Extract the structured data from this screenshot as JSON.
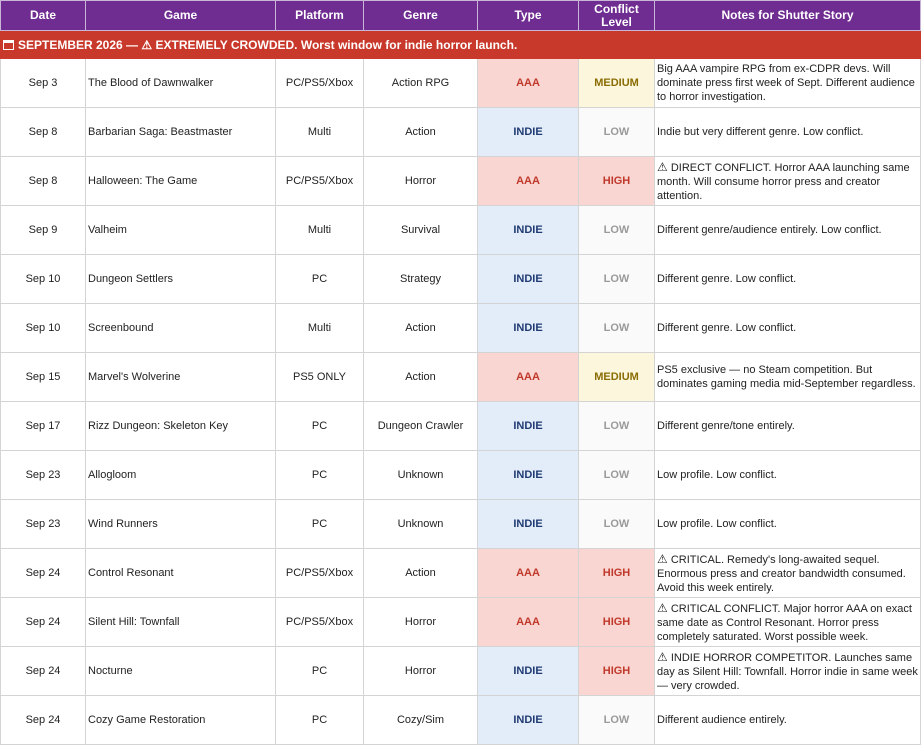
{
  "columns": [
    "Date",
    "Game",
    "Platform",
    "Genre",
    "Type",
    "Conflict Level",
    "Notes for Shutter Story"
  ],
  "banner": {
    "month_text": "SEPTEMBER 2026 — ",
    "warning_glyph": "⚠",
    "warning_text": " EXTREMELY CROWDED. Worst window for indie horror launch."
  },
  "colors": {
    "header_bg": "#6f2c91",
    "banner_bg": "#c8392b",
    "aaa_bg": "#f9d6d2",
    "indie_bg": "#e3edf9",
    "medium_bg": "#fcf6dc"
  },
  "rows": [
    {
      "date": "Sep 3",
      "game": "The Blood of Dawnwalker",
      "platform": "PC/PS5/Xbox",
      "genre": "Action RPG",
      "type": "AAA",
      "level": "MEDIUM",
      "warn": "",
      "notes": "Big AAA vampire RPG from ex-CDPR devs. Will dominate press first week of Sept. Different audience to horror investigation."
    },
    {
      "date": "Sep 8",
      "game": "Barbarian Saga: Beastmaster",
      "platform": "Multi",
      "genre": "Action",
      "type": "INDIE",
      "level": "LOW",
      "warn": "",
      "notes": "Indie but very different genre. Low conflict."
    },
    {
      "date": "Sep 8",
      "game": "Halloween: The Game",
      "platform": "PC/PS5/Xbox",
      "genre": "Horror",
      "type": "AAA",
      "level": "HIGH",
      "warn": "⚠",
      "notes": " DIRECT CONFLICT. Horror AAA launching same month. Will consume horror press and creator attention."
    },
    {
      "date": "Sep 9",
      "game": "Valheim",
      "platform": "Multi",
      "genre": "Survival",
      "type": "INDIE",
      "level": "LOW",
      "warn": "",
      "notes": "Different genre/audience entirely. Low conflict."
    },
    {
      "date": "Sep 10",
      "game": "Dungeon Settlers",
      "platform": "PC",
      "genre": "Strategy",
      "type": "INDIE",
      "level": "LOW",
      "warn": "",
      "notes": "Different genre. Low conflict."
    },
    {
      "date": "Sep 10",
      "game": "Screenbound",
      "platform": "Multi",
      "genre": "Action",
      "type": "INDIE",
      "level": "LOW",
      "warn": "",
      "notes": "Different genre. Low conflict."
    },
    {
      "date": "Sep 15",
      "game": "Marvel's Wolverine",
      "platform": "PS5 ONLY",
      "genre": "Action",
      "type": "AAA",
      "level": "MEDIUM",
      "warn": "",
      "notes": "PS5 exclusive — no Steam competition. But dominates gaming media mid-September regardless."
    },
    {
      "date": "Sep 17",
      "game": "Rizz Dungeon: Skeleton Key",
      "platform": "PC",
      "genre": "Dungeon Crawler",
      "type": "INDIE",
      "level": "LOW",
      "warn": "",
      "notes": "Different genre/tone entirely."
    },
    {
      "date": "Sep 23",
      "game": "Allogloom",
      "platform": "PC",
      "genre": "Unknown",
      "type": "INDIE",
      "level": "LOW",
      "warn": "",
      "notes": "Low profile. Low conflict."
    },
    {
      "date": "Sep 23",
      "game": "Wind Runners",
      "platform": "PC",
      "genre": "Unknown",
      "type": "INDIE",
      "level": "LOW",
      "warn": "",
      "notes": "Low profile. Low conflict."
    },
    {
      "date": "Sep 24",
      "game": "Control Resonant",
      "platform": "PC/PS5/Xbox",
      "genre": "Action",
      "type": "AAA",
      "level": "HIGH",
      "warn": "⚠",
      "notes": " CRITICAL. Remedy's long-awaited sequel. Enormous press and creator bandwidth consumed. Avoid this week entirely."
    },
    {
      "date": "Sep 24",
      "game": "Silent Hill: Townfall",
      "platform": "PC/PS5/Xbox",
      "genre": "Horror",
      "type": "AAA",
      "level": "HIGH",
      "warn": "⚠",
      "notes": " CRITICAL CONFLICT. Major horror AAA on exact same date as Control Resonant. Horror press completely saturated. Worst possible week."
    },
    {
      "date": "Sep 24",
      "game": "Nocturne",
      "platform": "PC",
      "genre": "Horror",
      "type": "INDIE",
      "level": "HIGH",
      "warn": "⚠",
      "notes": " INDIE HORROR COMPETITOR. Launches same day as Silent Hill: Townfall. Horror indie in same week — very crowded."
    },
    {
      "date": "Sep 24",
      "game": "Cozy Game Restoration",
      "platform": "PC",
      "genre": "Cozy/Sim",
      "type": "INDIE",
      "level": "LOW",
      "warn": "",
      "notes": "Different audience entirely."
    }
  ]
}
